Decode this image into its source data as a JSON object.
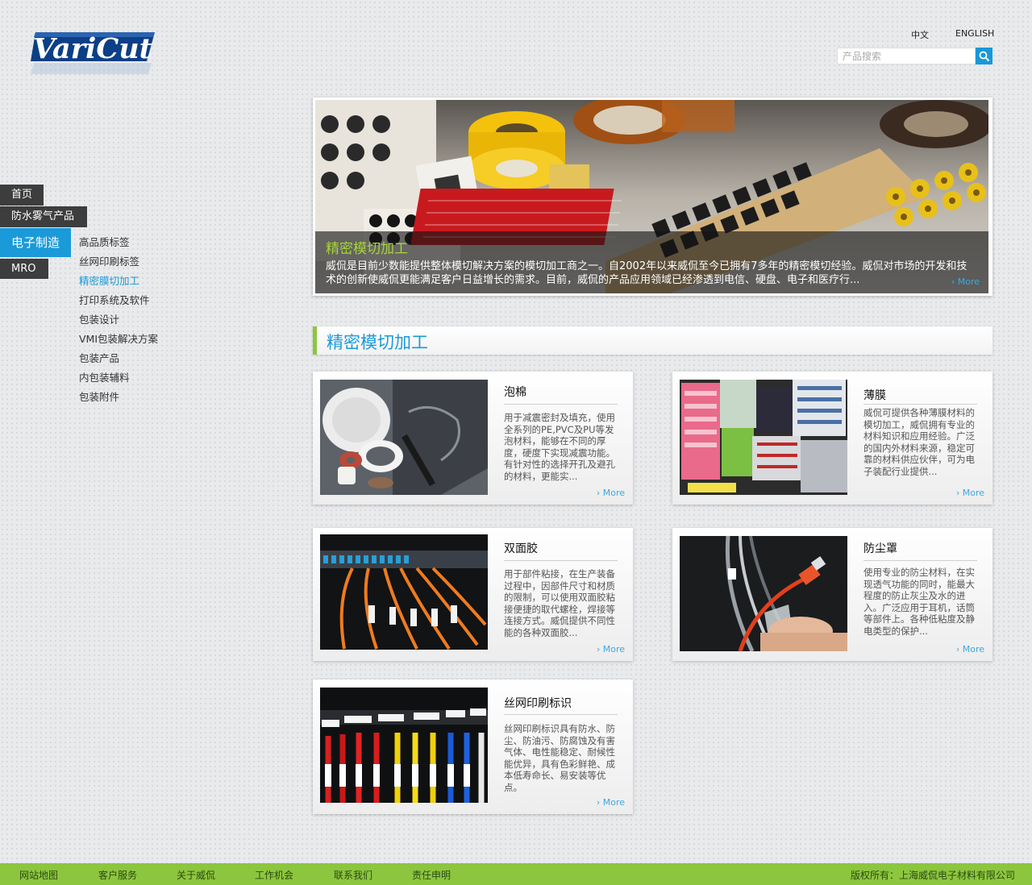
{
  "brand": {
    "logo_text": "VariCut"
  },
  "header": {
    "lang_zh": "中文",
    "lang_en": "ENGLISH",
    "search_placeholder": "产品搜索"
  },
  "nav": {
    "tabs": [
      "首页",
      "防水雾气产品",
      "电子制造",
      "MRO"
    ],
    "active_tab": "电子制造",
    "sub_items": [
      "高品质标签",
      "丝网印刷标签",
      "精密膜切加工",
      "打印系统及软件",
      "包装设计",
      "VMI包装解决方案",
      "包装产品",
      "内包装辅料",
      "包装附件"
    ],
    "active_sub": "精密膜切加工"
  },
  "banner": {
    "title": "精密模切加工",
    "text": "威侃是目前少数能提供整体模切解决方案的模切加工商之一。自2002年以来威侃至今已拥有7多年的精密模切经验。威侃对市场的开发和技术的创新使威侃更能满足客户日益增长的需求。目前，威侃的产品应用领域已经渗透到电信、硬盘、电子和医疗行...",
    "more": "More"
  },
  "section": {
    "title": "精密模切加工"
  },
  "cards": [
    {
      "title": "泡棉",
      "text": "用于减震密封及填充，使用全系列的PE,PVC及PU等发泡材料，能够在不同的厚度，硬度下实现减震功能。有针对性的选择开孔及避孔的材料，更能实...",
      "more": "More"
    },
    {
      "title": "薄膜",
      "text": "威侃可提供各种薄膜材料的模切加工，威侃拥有专业的材料知识和应用经验。广泛的国内外材料来源，稳定可靠的材料供应伙伴，可为电子装配行业提供...",
      "more": "More"
    },
    {
      "title": "双面胶",
      "text": "用于部件粘接，在生产装备过程中，因部件尺寸和材质的限制，可以使用双面胶粘接便捷的取代螺栓，焊接等连接方式。威侃提供不同性能的各种双面胶...",
      "more": "More"
    },
    {
      "title": "防尘罩",
      "text": "使用专业的防尘材料，在实现透气功能的同时，能最大程度的防止灰尘及水的进入。广泛应用于耳机，话筒等部件上。各种低粘度及静电类型的保护...",
      "more": "More"
    },
    {
      "title": "丝网印刷标识",
      "text": "丝网印刷标识具有防水、防尘、防油污、防腐蚀及有害气体、电性能稳定、耐候性能优异，具有色彩鲜艳、成本低寿命长、易安装等优点。",
      "more": "More"
    }
  ],
  "footer": {
    "links": [
      "网站地图",
      "客户服务",
      "关于威侃",
      "工作机会",
      "联系我们",
      "责任申明"
    ],
    "copyright": "版权所有：上海威侃电子材料有限公司"
  }
}
